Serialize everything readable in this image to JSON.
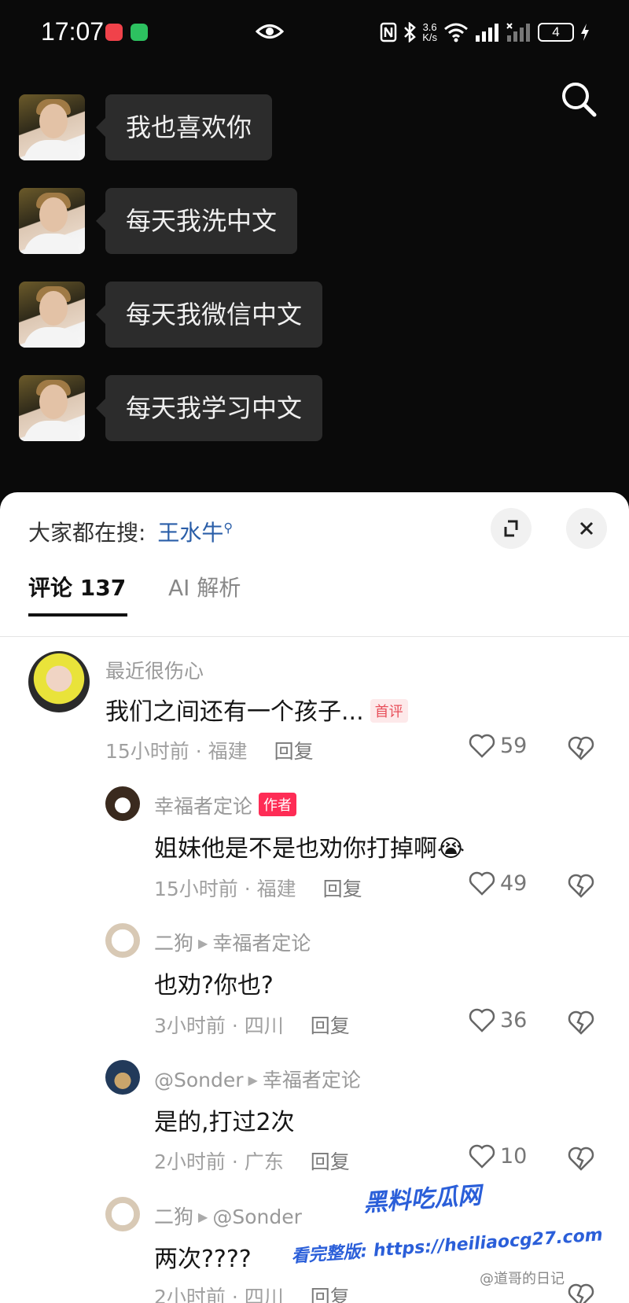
{
  "status_bar": {
    "time": "17:07",
    "network_speed": "3.6",
    "network_unit": "K/s",
    "battery": "4"
  },
  "chat": {
    "messages": [
      "我也喜欢你",
      "每天我洗中文",
      "每天我微信中文",
      "每天我学习中文"
    ]
  },
  "panel": {
    "hot_search_label": "大家都在搜:",
    "hot_search_term": "王水牛",
    "tabs": [
      {
        "label": "评论 137"
      },
      {
        "label": "AI 解析"
      }
    ],
    "reply_label": "回复"
  },
  "comments": [
    {
      "user": "最近很伤心",
      "text": "我们之间还有一个孩子...",
      "badge": "首评",
      "time": "15小时前",
      "location": "福建",
      "likes": "59"
    },
    {
      "user": "幸福者定论",
      "text": "姐妹他是不是也劝你打掉啊",
      "badge": "作者",
      "emoji": "😭",
      "time": "15小时前",
      "location": "福建",
      "likes": "49"
    },
    {
      "user": "二狗",
      "reply_to": "幸福者定论",
      "text": "也劝?你也?",
      "time": "3小时前",
      "location": "四川",
      "likes": "36"
    },
    {
      "user": "@Sonder",
      "reply_to": "幸福者定论",
      "text": "是的,打过2次",
      "time": "2小时前",
      "location": "广东",
      "likes": "10"
    },
    {
      "user": "二狗",
      "reply_to": "@Sonder",
      "text": "两次????",
      "time": "2小时前",
      "location": "四川"
    }
  ],
  "watermark": {
    "title": "黑料吃瓜网",
    "url": "看完整版: https://heiliaocg27.com",
    "weibo": "@道哥的日记"
  },
  "colors": {
    "link_blue": "#2a5ea8",
    "author_badge": "#fe2c55",
    "chat_bubble": "#2c2c2c"
  }
}
